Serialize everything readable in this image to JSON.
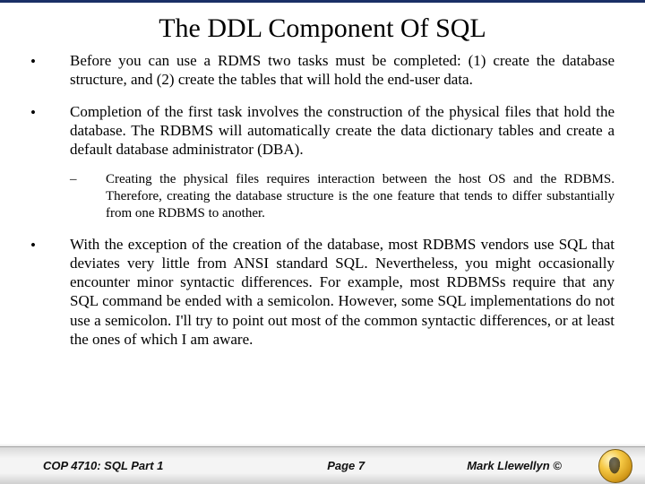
{
  "title": "The DDL Component Of SQL",
  "bullets": [
    {
      "text": "Before you can use a RDMS two tasks must be completed: (1) create the database structure, and (2) create the tables that will hold the end-user data."
    },
    {
      "text": "Completion of the first task involves the construction of the physical files that hold the database.  The RDBMS will automatically create the data dictionary tables and create a default database administrator (DBA).",
      "sub": [
        "Creating the physical files requires interaction between the host OS and the RDBMS.  Therefore, creating the database structure is the one feature that tends to differ substantially from one RDBMS to another."
      ]
    },
    {
      "text": "With the exception of the creation of the database, most RDBMS vendors use SQL that deviates very little from ANSI standard SQL. Nevertheless, you might occasionally encounter minor syntactic differences.  For example, most RDBMSs require that any SQL command be ended with a semicolon.  However, some SQL implementations do not use a semicolon.  I'll try to point out most of the common syntactic differences, or at least the ones of which I am aware."
    }
  ],
  "footer": {
    "left": "COP 4710: SQL Part 1",
    "center": "Page 7",
    "right": "Mark Llewellyn ©"
  }
}
